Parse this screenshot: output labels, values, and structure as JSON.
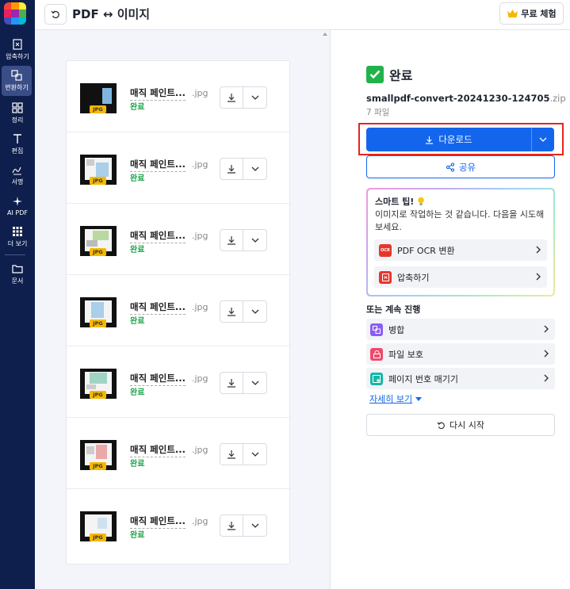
{
  "sidebar": {
    "items": [
      {
        "label": "압축하기",
        "icon": "compress-icon"
      },
      {
        "label": "변환하기",
        "icon": "convert-icon"
      },
      {
        "label": "정리",
        "icon": "organize-icon"
      },
      {
        "label": "편집",
        "icon": "edit-text-icon"
      },
      {
        "label": "서명",
        "icon": "sign-icon"
      },
      {
        "label": "AI PDF",
        "icon": "ai-sparkle-icon"
      },
      {
        "label": "더 보기",
        "icon": "grid-icon"
      },
      {
        "label": "문서",
        "icon": "folder-icon"
      }
    ],
    "active_index": 1
  },
  "header": {
    "title": "PDF ↔ 이미지",
    "trial_label": "무료 체험"
  },
  "files": [
    {
      "name": "매직 페인트...",
      "ext": ".jpg",
      "status": "완료",
      "badge": "JPG"
    },
    {
      "name": "매직 페인트...",
      "ext": ".jpg",
      "status": "완료",
      "badge": "JPG"
    },
    {
      "name": "매직 페인트...",
      "ext": ".jpg",
      "status": "완료",
      "badge": "JPG"
    },
    {
      "name": "매직 페인트...",
      "ext": ".jpg",
      "status": "완료",
      "badge": "JPG"
    },
    {
      "name": "매직 페인트...",
      "ext": ".jpg",
      "status": "완료",
      "badge": "JPG"
    },
    {
      "name": "매직 페인트...",
      "ext": ".jpg",
      "status": "완료",
      "badge": "JPG"
    },
    {
      "name": "매직 페인트...",
      "ext": ".jpg",
      "status": "완료",
      "badge": "JPG"
    }
  ],
  "result": {
    "status": "완료",
    "zip_name": "smallpdf-convert-20241230-124705",
    "zip_ext": ".zip",
    "file_count": "7 파일",
    "download_label": "다운로드",
    "share_label": "공유"
  },
  "tip": {
    "title": "스마트 팁!",
    "text": "이미지로 작업하는 것 같습니다. 다음을 시도해 보세요.",
    "actions": [
      {
        "label": "PDF OCR 변환",
        "icon": "ocr-icon",
        "color": "#e8352b"
      },
      {
        "label": "압축하기",
        "icon": "compress-icon",
        "color": "#e8352b"
      }
    ]
  },
  "continue": {
    "title": "또는 계속 진행",
    "items": [
      {
        "label": "병합",
        "icon": "merge-icon",
        "color": "#8b5cf6"
      },
      {
        "label": "파일 보호",
        "icon": "lock-icon",
        "color": "#ef4a6b"
      },
      {
        "label": "페이지 번호 매기기",
        "icon": "page-number-icon",
        "color": "#14b8a6"
      }
    ],
    "see_more": "자세히 보기",
    "restart_label": "다시 시작"
  },
  "colors": {
    "sidebar_bg": "#0e1f4d",
    "accent": "#1366ec",
    "success": "#22b24c",
    "highlight": "#e8231e"
  }
}
